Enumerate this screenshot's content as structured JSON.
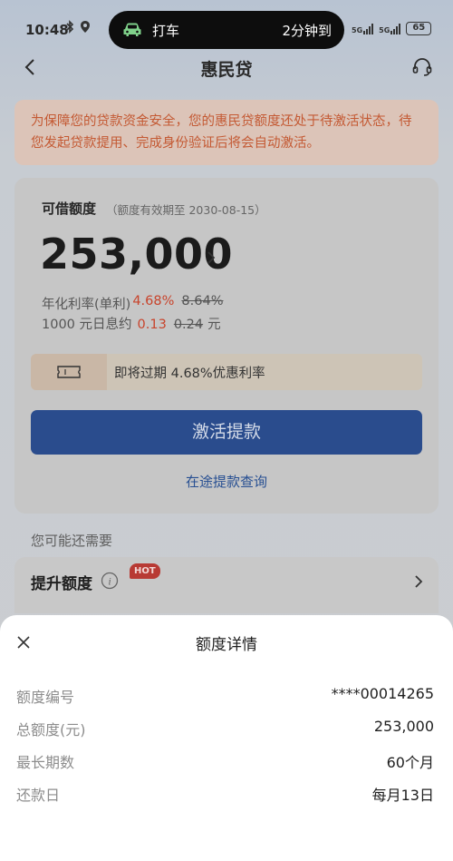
{
  "status_bar": {
    "time": "10:48",
    "island_app": "打车",
    "island_status": "2分钟到",
    "network_1": "5G",
    "network_2": "5G",
    "battery": "65"
  },
  "nav": {
    "title": "惠民贷",
    "icons": {
      "back": "back-arrow-icon",
      "service": "headset-icon"
    }
  },
  "notice": {
    "text": "为保障您的贷款资金安全，您的惠民贷额度还处于待激活状态，待您发起贷款提用、完成身份验证后将会自动激活。"
  },
  "credit": {
    "label": "可借额度",
    "validity": "（额度有效期至 2030-08-15）",
    "amount": "253,000",
    "rate_label": "年化利率(单利)",
    "rate_current": "4.68%",
    "rate_original": "8.64%",
    "interest_prefix": "1000 元日息约",
    "interest_current": "0.13",
    "interest_original": "0.24",
    "interest_unit": "元"
  },
  "coupon": {
    "text": "即将过期 4.68%优惠利率",
    "icon": "ticket-icon"
  },
  "actions": {
    "activate_label": "激活提款",
    "query_label": "在途提款查询"
  },
  "more": {
    "section_label": "您可能还需要",
    "promote_label": "提升额度",
    "hot_badge": "HOT"
  },
  "sheet": {
    "title": "额度详情",
    "rows": [
      {
        "label": "额度编号",
        "value": "****00014265"
      },
      {
        "label": "总额度(元)",
        "value": "253,000"
      },
      {
        "label": "最长期数",
        "value": "60个月"
      },
      {
        "label": "还款日",
        "value": "每月13日"
      }
    ]
  },
  "colors": {
    "accent_blue": "#2a4c8d",
    "highlight_red": "#c8442c",
    "notice_text": "#c45a34"
  }
}
